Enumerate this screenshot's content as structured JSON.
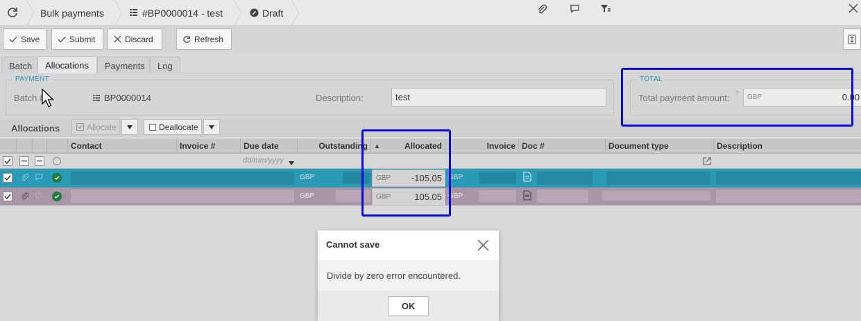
{
  "titlebar": {
    "crumbs": [
      "Bulk payments",
      "#BP0000014 - test",
      "Draft"
    ]
  },
  "toolbar": {
    "save": "Save",
    "submit": "Submit",
    "discard": "Discard",
    "refresh": "Refresh"
  },
  "tabs": [
    "Batch",
    "Allocations",
    "Payments",
    "Log"
  ],
  "payment": {
    "legend": "PAYMENT",
    "batch_label": "Batch #",
    "batch_value": "BP0000014",
    "description_label": "Description:",
    "description_value": "test"
  },
  "total": {
    "legend": "TOTAL",
    "label": "Total payment amount:",
    "hint": "?",
    "currency": "GBP",
    "value": "0.00"
  },
  "allocations": {
    "title": "Allocations",
    "allocate": "Allocate",
    "deallocate": "Deallocate"
  },
  "grid": {
    "columns": {
      "contact": "Contact",
      "invoice_no": "Invoice #",
      "due_date": "Due date",
      "outstanding": "Outstanding",
      "allocated": "Allocated",
      "invoice": "Invoice",
      "doc_no": "Doc #",
      "document_type": "Document type",
      "description": "Description"
    },
    "due_date_placeholder": "dd/mm/yyyy",
    "sort_arrow": "▲",
    "rows": [
      {
        "outstanding_currency": "GBP",
        "allocated_currency": "GBP",
        "allocated": "-105.05",
        "invoice_currency": "GBP"
      },
      {
        "outstanding_currency": "GBP",
        "allocated_currency": "GBP",
        "allocated": "105.05",
        "invoice_currency": "GBP"
      }
    ]
  },
  "dialog": {
    "title": "Cannot save",
    "message": "Divide by zero error encountered.",
    "ok": "OK"
  },
  "colors": {
    "selected_row": "#2a9bb5",
    "second_row": "#a895a6",
    "highlight": "#0a0ad8",
    "legend": "#2a8fbd"
  }
}
